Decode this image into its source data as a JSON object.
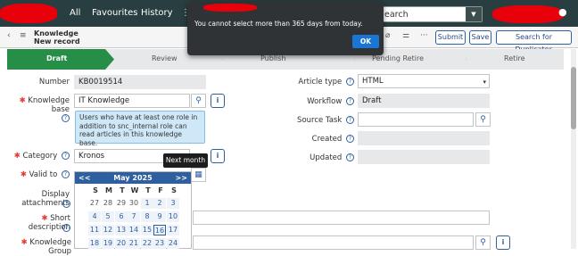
{
  "nav": {
    "all": "All",
    "favourites": "Favourites",
    "history": "History",
    "search_placeholder": "earch"
  },
  "subheader": {
    "table_name": "Knowledge",
    "record_title": "New record"
  },
  "toolbar": {
    "submit": "Submit",
    "save": "Save",
    "search_duplicates": "Search for Duplicates"
  },
  "stages": [
    "Draft",
    "Review",
    "Publish",
    "Pending Retire",
    "Retire"
  ],
  "form": {
    "number_label": "Number",
    "number_value": "KB0019514",
    "kb_label": "Knowledge base",
    "kb_value": "IT Knowledge",
    "kb_hint": "Users who have at least one role in addition to snc_internal role can read articles in this knowledge base.",
    "category_label": "Category",
    "category_value": "Kronos",
    "valid_to_label": "Valid to",
    "display_attachments_label": "Display attachments",
    "short_description_label": "Short description",
    "knowledge_group_label": "Knowledge Group",
    "article_type_label": "Article type",
    "article_type_value": "HTML",
    "workflow_label": "Workflow",
    "workflow_value": "Draft",
    "source_task_label": "Source Task",
    "created_label": "Created",
    "updated_label": "Updated"
  },
  "tooltip": "Next month",
  "calendar": {
    "month_label": "May 2025",
    "prev": "<<",
    "next": ">>",
    "weekdays": [
      "S",
      "M",
      "T",
      "W",
      "T",
      "F",
      "S"
    ],
    "weeks": [
      [
        "27",
        "28",
        "29",
        "30",
        "1",
        "2",
        "3"
      ],
      [
        "4",
        "5",
        "6",
        "7",
        "8",
        "9",
        "10"
      ],
      [
        "11",
        "12",
        "13",
        "14",
        "15",
        "16",
        "17"
      ],
      [
        "18",
        "19",
        "20",
        "21",
        "22",
        "23",
        "24"
      ]
    ]
  },
  "modal": {
    "message": "You cannot select more than 365 days from today.",
    "ok": "OK"
  }
}
